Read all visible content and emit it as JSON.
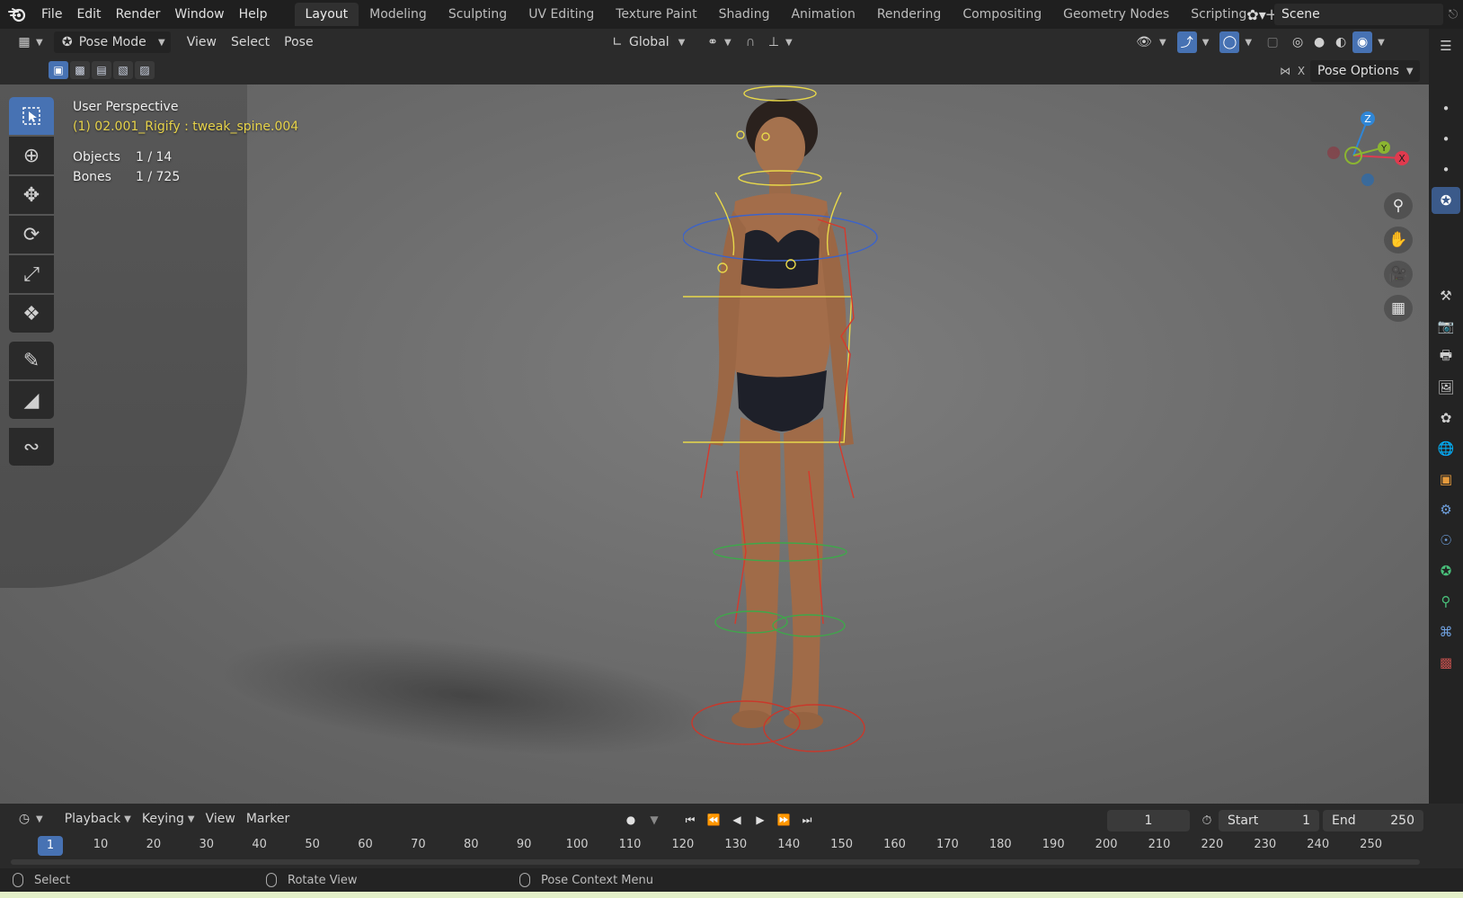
{
  "topbar": {
    "menus": [
      "File",
      "Edit",
      "Render",
      "Window",
      "Help"
    ],
    "workspaces": [
      "Layout",
      "Modeling",
      "Sculpting",
      "UV Editing",
      "Texture Paint",
      "Shading",
      "Animation",
      "Rendering",
      "Compositing",
      "Geometry Nodes",
      "Scripting"
    ],
    "active_workspace": "Layout",
    "scene_name": "Scene"
  },
  "viewport_header": {
    "mode": "Pose Mode",
    "menus": [
      "View",
      "Select",
      "Pose"
    ],
    "orientation": "Global"
  },
  "tool_settings": {
    "pose_options": "Pose Options",
    "x_mirror": "X"
  },
  "overlay": {
    "view_name": "User Perspective",
    "active": "(1) 02.001_Rigify : tweak_spine.004",
    "objects_label": "Objects",
    "objects_value": "1 / 14",
    "bones_label": "Bones",
    "bones_value": "1 / 725"
  },
  "gizmo": {
    "x": "X",
    "y": "Y",
    "z": "Z"
  },
  "timeline": {
    "menus": [
      "Playback",
      "Keying",
      "View",
      "Marker"
    ],
    "current_frame": "1",
    "start_label": "Start",
    "start_value": "1",
    "end_label": "End",
    "end_value": "250",
    "ruler_current": "1",
    "ruler_ticks": [
      "10",
      "20",
      "30",
      "40",
      "50",
      "60",
      "70",
      "80",
      "90",
      "100",
      "110",
      "120",
      "130",
      "140",
      "150",
      "160",
      "170",
      "180",
      "190",
      "200",
      "210",
      "220",
      "230",
      "240",
      "250"
    ]
  },
  "statusbar": {
    "left": "Select",
    "middle": "Rotate View",
    "right": "Pose Context Menu"
  },
  "colors": {
    "accent": "#4772b3",
    "active_bone_text": "#e7d34a",
    "axis_x": "#e03a4e",
    "axis_y": "#8bb531",
    "axis_z": "#2f86d6"
  }
}
